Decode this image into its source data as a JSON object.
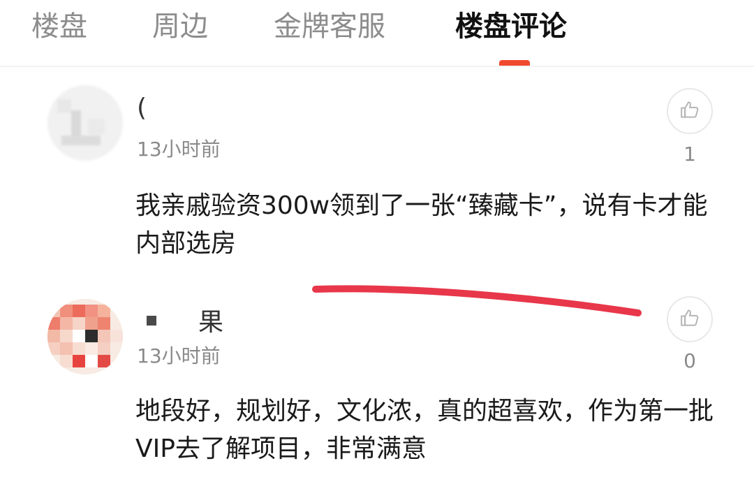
{
  "tabs": [
    {
      "label": "楼盘",
      "active": false
    },
    {
      "label": "周边",
      "active": false
    },
    {
      "label": "金牌客服",
      "active": false
    },
    {
      "label": "楼盘评论",
      "active": true
    }
  ],
  "colors": {
    "accent": "#f0492e",
    "annotation": "#e8374a",
    "text_primary": "#1a1a1a",
    "text_secondary": "#8a8a8a"
  },
  "comments": [
    {
      "username": "(",
      "time": "13小时前",
      "likes": "1",
      "like_icon": "thumbs-up-icon",
      "text": "我亲戚验资300w领到了一张“臻藏卡”，说有卡才能内部选房"
    },
    {
      "username": "果",
      "time": "13小时前",
      "likes": "0",
      "like_icon": "thumbs-up-icon",
      "text": "地段好，规划好，文化浓，真的超喜欢，作为第一批VIP去了解项目，非常满意"
    }
  ]
}
